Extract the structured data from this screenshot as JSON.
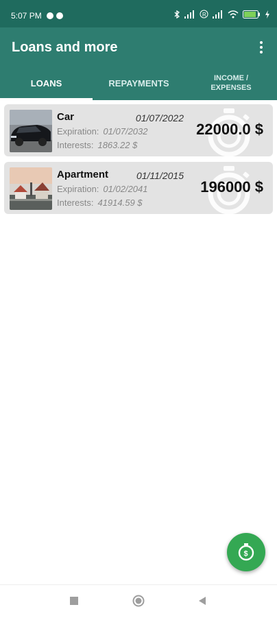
{
  "status_bar": {
    "time": "5:07 PM",
    "battery": "80"
  },
  "app_bar": {
    "title": "Loans and more"
  },
  "tabs": [
    {
      "label": "LOANS",
      "active": true
    },
    {
      "label": "REPAYMENTS",
      "active": false
    },
    {
      "label": "INCOME / EXPENSES",
      "active": false
    }
  ],
  "loans": [
    {
      "name": "Car",
      "date": "01/07/2022",
      "expiration_label": "Expiration:",
      "expiration": "01/07/2032",
      "interests_label": "Interests:",
      "interests": "1863.22 $",
      "amount": "22000.0 $",
      "image": "car-photo"
    },
    {
      "name": "Apartment",
      "date": "01/11/2015",
      "expiration_label": "Expiration:",
      "expiration": "01/02/2041",
      "interests_label": "Interests:",
      "interests": "41914.59 $",
      "amount": "196000 $",
      "image": "house-photo"
    }
  ],
  "fab": {
    "icon": "stopwatch-dollar-icon"
  },
  "colors": {
    "primary": "#2e7d70",
    "status": "#1f6b5e",
    "fab": "#34a853",
    "card": "#e3e3e3"
  }
}
